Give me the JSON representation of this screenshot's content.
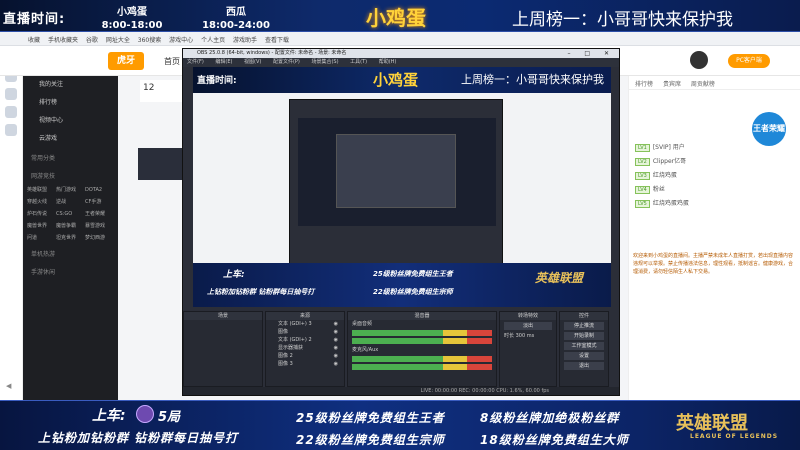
{
  "overlay": {
    "live_time_label": "直播时间:",
    "host1_name": "小鸡蛋",
    "host1_time": "8:00-18:00",
    "host2_name": "西瓜",
    "host2_time": "18:00-24:00",
    "center_title": "小鸡蛋",
    "rank_text": "上周榜一：小哥哥快来保护我",
    "bottom_line1_prefix": "上车:",
    "bottom_line1_num": "5局",
    "bottom_line2": "上钻粉加钻粉群  钻粉群每日抽号打",
    "col_a1": "25级粉丝牌免费组生王者",
    "col_a2": "22级粉丝牌免费组生宗师",
    "col_b1": "8级粉丝牌加绝极粉丝群",
    "col_b2": "18级粉丝牌免费组生大师",
    "lol_logo": "英雄联盟",
    "lol_sub": "LEAGUE OF LEGENDS"
  },
  "browser": {
    "bookmarks": [
      "收藏",
      "手机收藏夹",
      "谷歌",
      "网址大全",
      "360搜索",
      "游戏中心",
      "个人主页",
      "游戏助手",
      "查看下载"
    ],
    "nav_home": "首页",
    "pc_button": "PC客户端",
    "stat_number": "12"
  },
  "sidebar": {
    "items": [
      "我的关注",
      "排行榜",
      "视频中心",
      "云游戏"
    ],
    "section_title": "常用分类",
    "section2": "网游竞技",
    "grid": [
      "英雄联盟",
      "热门游戏",
      "DOTA2",
      "穿越火线",
      "逆战",
      "CF手游",
      "炉石传说",
      "CS:GO",
      "王者荣耀",
      "魔兽世界",
      "魔兽争霸",
      "暴雪游戏",
      "问道",
      "坦克世界",
      "梦幻西游"
    ],
    "section3": "单机热游",
    "section4": "手游休闲"
  },
  "right_panel": {
    "tabs": [
      "排行榜",
      "贵宾席",
      "周贡献榜"
    ],
    "rows": [
      {
        "lvl": "LV1",
        "text": "[SVIP] 用户"
      },
      {
        "lvl": "LV2",
        "text": "Clipper亿哥"
      },
      {
        "lvl": "LV3",
        "text": "红烧鸡蛋"
      },
      {
        "lvl": "LV4",
        "text": "粉丝"
      },
      {
        "lvl": "LV5",
        "text": "红烧鸡蛋鸡蛋"
      }
    ],
    "notice": "欢迎来到小鸡蛋的直播间。主播严禁未成年人直播打赏，若出现直播内容违规可以举报。禁止传播违法信息，理性观看，抵制谣言。健康游戏，合理消费，请勿轻信陌生人私下交易。",
    "badge": "王者荣耀"
  },
  "obs": {
    "title": "OBS 25.0.8 (64-bit, windows) - 配置文件: 未命名 - 场景: 未命名",
    "menu": [
      "文件(F)",
      "编辑(E)",
      "视图(V)",
      "配置文件(P)",
      "场景集合(S)",
      "工具(T)",
      "帮助(H)"
    ],
    "dock_scenes": "场景",
    "dock_sources": "来源",
    "dock_mixer": "混音器",
    "dock_transitions": "转场特效",
    "dock_controls": "控件",
    "sources": [
      "文本 (GDI+) 3",
      "图像",
      "文本 (GDI+) 2",
      "显示器捕获",
      "图像 2",
      "图像 3"
    ],
    "mixer_desktop": "桌面音频",
    "mixer_mic": "麦克风/Aux",
    "transition_label": "淡出",
    "duration_label": "时长",
    "duration": "300 ms",
    "controls": [
      "停止推流",
      "开始录制",
      "工作室模式",
      "设置",
      "退出"
    ],
    "status": "LIVE: 00:00:00  REC: 00:00:00  CPU: 1.6%, 60.00 fps"
  }
}
